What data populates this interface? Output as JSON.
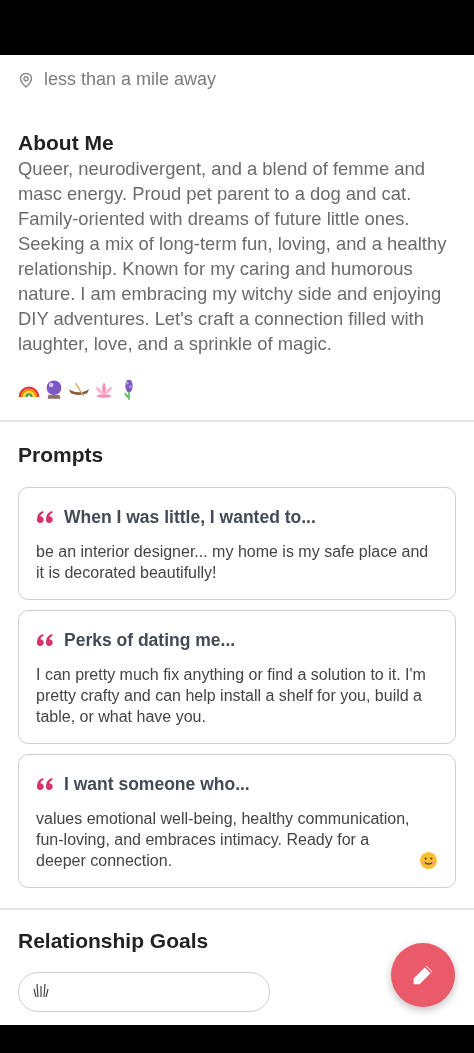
{
  "profile_details": [
    {
      "kind": "distance",
      "text": "less than a mile away"
    }
  ],
  "about_me": {
    "title": "About Me",
    "text": "Queer, neurodivergent, and a blend of femme and masc energy. Proud pet parent to a dog and cat. Family-oriented with dreams of future little ones. Seeking a mix of long-term fun, loving, and a healthy relationship. Known for my caring and humorous nature. I am embracing my witchy side and enjoying DIY adventures. Let's craft a connection filled with laughter, love, and a sprinkle of magic.",
    "emojis": [
      {
        "kind": "rainbow"
      },
      {
        "kind": "crystal-ball"
      },
      {
        "kind": "canoe"
      },
      {
        "kind": "lotus"
      },
      {
        "kind": "hyacinth"
      }
    ]
  },
  "prompts": {
    "title": "Prompts",
    "items": [
      {
        "question": "When I was little, I wanted to...",
        "answer": "be an interior designer... my home is my safe place and it is decorated beautifully!"
      },
      {
        "question": "Perks of dating me...",
        "answer": "I can pretty much fix anything or find a solution to it. I'm pretty crafty and can help install a shelf for you, build a table, or what have you."
      },
      {
        "question": "I want someone who...",
        "answer": "values emotional well-being, healthy communication, fun-loving, and embraces intimacy. Ready for a deeper connection.",
        "icon": {
          "kind": "smiley"
        }
      }
    ]
  },
  "relationship_goals": {
    "title": "Relationship Goals"
  }
}
